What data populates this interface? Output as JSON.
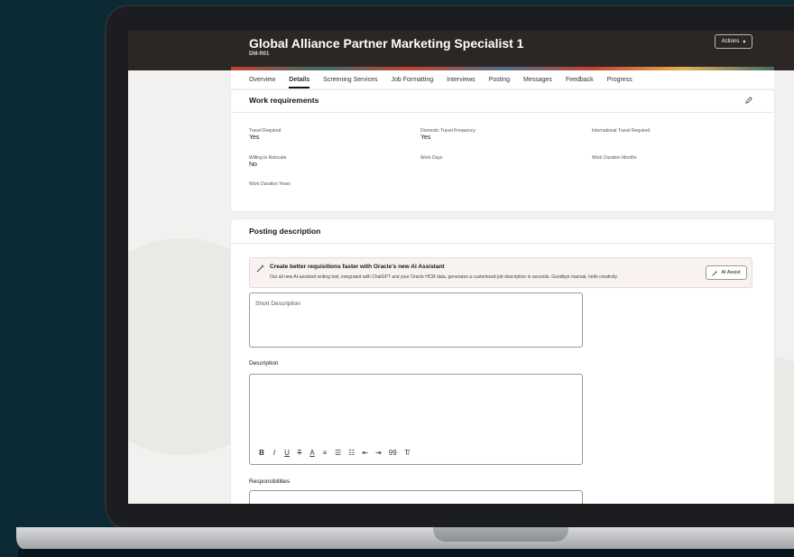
{
  "header": {
    "title": "Global Alliance Partner Marketing Specialist 1",
    "subtitle": "DM-R01",
    "actions_label": "Actions"
  },
  "tabs": [
    {
      "label": "Overview"
    },
    {
      "label": "Details",
      "active": true
    },
    {
      "label": "Screening Services"
    },
    {
      "label": "Job Formatting"
    },
    {
      "label": "Interviews"
    },
    {
      "label": "Posting"
    },
    {
      "label": "Messages"
    },
    {
      "label": "Feedback"
    },
    {
      "label": "Progress"
    }
  ],
  "work_requirements": {
    "title": "Work requirements",
    "fields": {
      "travel_required": {
        "label": "Travel Required",
        "value": "Yes"
      },
      "domestic_travel_frequency": {
        "label": "Domestic Travel Frequency",
        "value": "Yes"
      },
      "international_travel_required": {
        "label": "International Travel Required",
        "value": ""
      },
      "willing_to_relocate": {
        "label": "Willing to Relocate",
        "value": "No"
      },
      "work_days": {
        "label": "Work Days",
        "value": ""
      },
      "work_duration_months": {
        "label": "Work Duration Months",
        "value": ""
      },
      "work_duration_years": {
        "label": "Work Duration Years",
        "value": ""
      }
    }
  },
  "posting_description": {
    "title": "Posting description",
    "ai_banner": {
      "title": "Create better requisitions faster with Oracle's new AI Assistant",
      "text": "Our all new AI-assisted writing tool, integrated with ChatGPT and your Oracle HCM data, generates a customized job description in seconds. Goodbye manual, hello creativity.",
      "button_label": "AI Assist"
    },
    "short_description_placeholder": "Short Description",
    "description_label": "Description",
    "responsibilities_label": "Responsibilities",
    "toolbar": [
      "B",
      "I",
      "U",
      "T",
      "A",
      "≡",
      "☰",
      "☷",
      "⇤",
      "⇥",
      "99",
      "T̸"
    ]
  },
  "colors": {
    "header_bg": "#2c2624",
    "page_bg": "#0b2a33",
    "accent_red": "#c7402f"
  }
}
